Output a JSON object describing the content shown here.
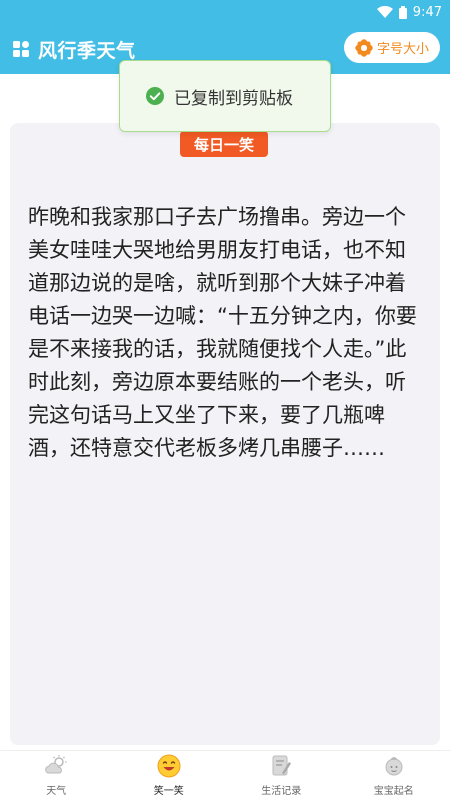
{
  "status_bar": {
    "time": "9:47"
  },
  "app_bar": {
    "title": "风行季天气",
    "font_size_button": "字号大小"
  },
  "toast": {
    "message": "已复制到剪贴板"
  },
  "card": {
    "badge": "每日一笑",
    "joke": "昨晚和我家那口子去广场撸串。旁边一个美女哇哇大哭地给男朋友打电话，也不知道那边说的是啥，就听到那个大妹子冲着电话一边哭一边喊：“十五分钟之内，你要是不来接我的话，我就随便找个人走。”此时此刻，旁边原本要结账的一个老头，听完这句话马上又坐了下来，要了几瓶啤酒，还特意交代老板多烤几串腰子……"
  },
  "tabs": [
    {
      "label": "天气",
      "icon": "weather-icon"
    },
    {
      "label": "笑一笑",
      "icon": "smile-icon",
      "active": true
    },
    {
      "label": "生活记录",
      "icon": "notebook-icon"
    },
    {
      "label": "宝宝起名",
      "icon": "baby-icon"
    }
  ],
  "colors": {
    "primary": "#42bde5",
    "accent_orange": "#f28a1e",
    "badge_red": "#f15a24",
    "toast_bg": "#f0f9eb",
    "toast_green": "#4caf50",
    "card_bg": "#f2f2f7"
  }
}
